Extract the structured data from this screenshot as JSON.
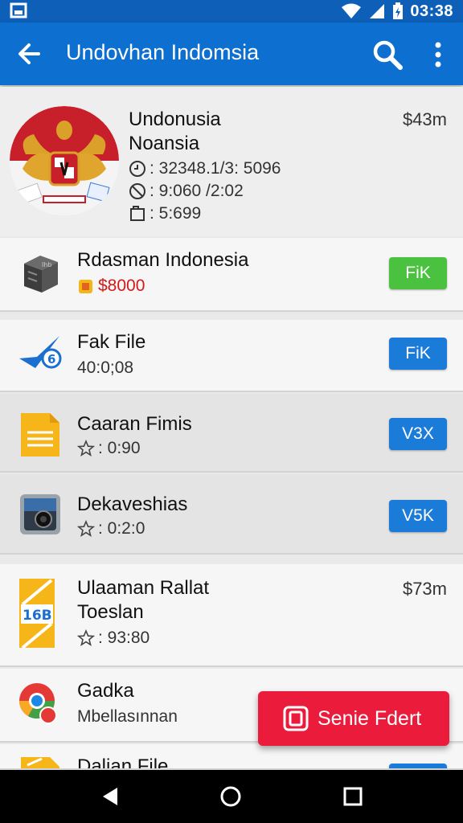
{
  "status_bar": {
    "time": "03:38"
  },
  "app_bar": {
    "title": "Undovhan Indomsia"
  },
  "hero": {
    "name_line1": "Undonusia",
    "name_line2": "Noansia",
    "price": "$43m",
    "stat1": ": 32348.1/3: 5096",
    "stat2": ": 9:060 /2:02",
    "stat3": ": 5:699"
  },
  "rows": [
    {
      "title": "Rdasman Indonesia",
      "sub": "$8000",
      "button": "FiK",
      "icon": "server-box-icon",
      "button_color": "#4bc23f"
    },
    {
      "title": "Fak File",
      "sub": "40:0;08",
      "button": "FiK",
      "icon": "checkmark-badge-icon",
      "button_color": "#1a7bd8"
    },
    {
      "title": "Caaran Fimis",
      "sub": ": 0:90",
      "button": "V3X",
      "icon": "document-icon",
      "button_color": "#1a7bd8"
    },
    {
      "title": "Dekaveshias",
      "sub": ": 0:2:0",
      "button": "V5K",
      "icon": "camera-icon",
      "button_color": "#1a7bd8"
    },
    {
      "title_line1": "Ulaaman Rallat",
      "title_line2": "Toeslan",
      "sub": ": 93:80",
      "price": "$73m",
      "icon": "calendar-book-icon",
      "icon_text": "16B"
    },
    {
      "title": "Gadka",
      "sub": "Mbellasınnan",
      "icon": "chrome-like-icon"
    },
    {
      "title": "Dalian File",
      "icon": "document-icon"
    }
  ],
  "fab": {
    "label": "Senie Fdert"
  },
  "colors": {
    "app_bar": "#0d6fcf",
    "status_bar": "#0d5fb8",
    "fab": "#ea1b3b",
    "green": "#4bc23f",
    "blue": "#1a7bd8"
  }
}
